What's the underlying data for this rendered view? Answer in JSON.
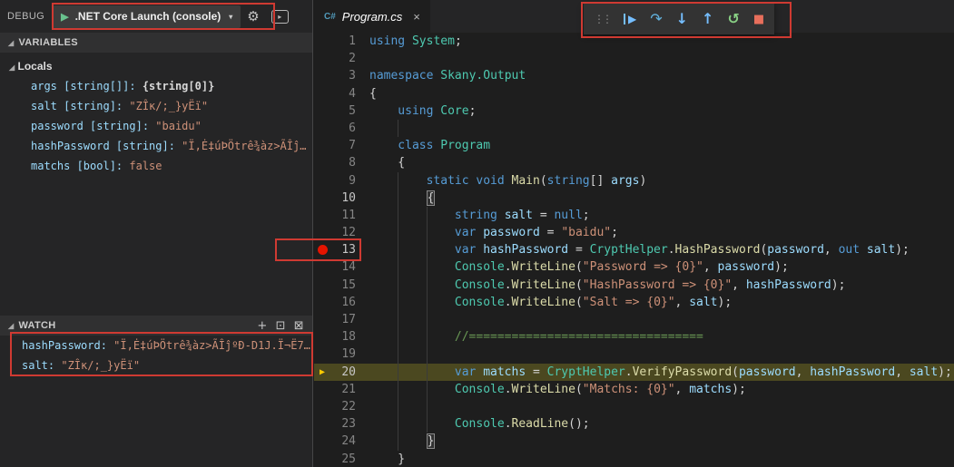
{
  "sidebar": {
    "title": "DEBUG",
    "launch_config": ".NET Core Launch (console)",
    "variables_header": "VARIABLES",
    "locals_label": "Locals",
    "watch_header": "WATCH",
    "variables": [
      {
        "name": "args [string[]]:",
        "value": "{string[0]}",
        "kind": "obj"
      },
      {
        "name": "salt [string]:",
        "value": "\"ZÎĸ/;_}yËï\"",
        "kind": "str"
      },
      {
        "name": "password [string]:",
        "value": "\"baidu\"",
        "kind": "str"
      },
      {
        "name": "hashPassword [string]:",
        "value": "\"Ï,Ė‡úÞÖtrê¾àz>ÃÎĵ…",
        "kind": "str"
      },
      {
        "name": "matchs [bool]:",
        "value": "false",
        "kind": "bool"
      }
    ],
    "watch": [
      {
        "name": "hashPassword:",
        "value": "\"Ï,Ė‡úÞÖtrê¾àz>ÃÎĵºÐ-D1J.Ï¬Ë7…"
      },
      {
        "name": "salt:",
        "value": "\"ZÎĸ/;_}yËï\""
      }
    ],
    "icons": {
      "twisty": "◢",
      "play": "▶",
      "caret": "▾",
      "gear": "⚙",
      "console": "▸",
      "add": "+",
      "collapse": "⊡",
      "close": "⊠"
    }
  },
  "toolbar": {
    "grip": "⋮⋮",
    "continue": "▶",
    "step_over": "↷",
    "step_into": "↓",
    "step_out": "↑",
    "restart": "↺",
    "stop": "■"
  },
  "tab": {
    "icon": "C#",
    "label": "Program.cs",
    "close": "×"
  },
  "editor": {
    "breakpoint_line": 13,
    "current_line": 20,
    "lines": [
      {
        "n": 1,
        "i": 0,
        "t": [
          [
            "kw",
            "using"
          ],
          [
            "pl",
            " "
          ],
          [
            "cls",
            "System"
          ],
          [
            "pl",
            ";"
          ]
        ]
      },
      {
        "n": 2,
        "i": 0,
        "t": []
      },
      {
        "n": 3,
        "i": 0,
        "t": [
          [
            "kw",
            "namespace"
          ],
          [
            "pl",
            " "
          ],
          [
            "cls",
            "Skany.Output"
          ]
        ]
      },
      {
        "n": 4,
        "i": 0,
        "t": [
          [
            "pl",
            "{"
          ]
        ]
      },
      {
        "n": 5,
        "i": 1,
        "t": [
          [
            "kw",
            "using"
          ],
          [
            "pl",
            " "
          ],
          [
            "cls",
            "Core"
          ],
          [
            "pl",
            ";"
          ]
        ]
      },
      {
        "n": 6,
        "i": 2,
        "t": []
      },
      {
        "n": 7,
        "i": 1,
        "t": [
          [
            "kw",
            "class"
          ],
          [
            "pl",
            " "
          ],
          [
            "cls",
            "Program"
          ]
        ]
      },
      {
        "n": 8,
        "i": 1,
        "t": [
          [
            "pl",
            "{"
          ]
        ]
      },
      {
        "n": 9,
        "i": 2,
        "t": [
          [
            "kw",
            "static"
          ],
          [
            "pl",
            " "
          ],
          [
            "kw",
            "void"
          ],
          [
            "pl",
            " "
          ],
          [
            "fn",
            "Main"
          ],
          [
            "pl",
            "("
          ],
          [
            "kw",
            "string"
          ],
          [
            "pl",
            "[] "
          ],
          [
            "vr",
            "args"
          ],
          [
            "pl",
            ")"
          ]
        ]
      },
      {
        "n": 10,
        "i": 2,
        "t": [
          [
            "brace",
            "{"
          ]
        ],
        "bright": true
      },
      {
        "n": 11,
        "i": 3,
        "t": [
          [
            "kw",
            "string"
          ],
          [
            "pl",
            " "
          ],
          [
            "vr",
            "salt"
          ],
          [
            "pl",
            " = "
          ],
          [
            "kw",
            "null"
          ],
          [
            "pl",
            ";"
          ]
        ]
      },
      {
        "n": 12,
        "i": 3,
        "t": [
          [
            "kw",
            "var"
          ],
          [
            "pl",
            " "
          ],
          [
            "vr",
            "password"
          ],
          [
            "pl",
            " = "
          ],
          [
            "str",
            "\"baidu\""
          ],
          [
            "pl",
            ";"
          ]
        ]
      },
      {
        "n": 13,
        "i": 3,
        "t": [
          [
            "kw",
            "var"
          ],
          [
            "pl",
            " "
          ],
          [
            "vr",
            "hashPassword"
          ],
          [
            "pl",
            " = "
          ],
          [
            "cls",
            "CryptHelper"
          ],
          [
            "pl",
            "."
          ],
          [
            "fn",
            "HashPassword"
          ],
          [
            "pl",
            "("
          ],
          [
            "vr",
            "password"
          ],
          [
            "pl",
            ", "
          ],
          [
            "kw",
            "out"
          ],
          [
            "pl",
            " "
          ],
          [
            "vr",
            "salt"
          ],
          [
            "pl",
            ");"
          ]
        ],
        "bright": true
      },
      {
        "n": 14,
        "i": 3,
        "t": [
          [
            "cls",
            "Console"
          ],
          [
            "pl",
            "."
          ],
          [
            "fn",
            "WriteLine"
          ],
          [
            "pl",
            "("
          ],
          [
            "str",
            "\"Password => {0}\""
          ],
          [
            "pl",
            ", "
          ],
          [
            "vr",
            "password"
          ],
          [
            "pl",
            ");"
          ]
        ]
      },
      {
        "n": 15,
        "i": 3,
        "t": [
          [
            "cls",
            "Console"
          ],
          [
            "pl",
            "."
          ],
          [
            "fn",
            "WriteLine"
          ],
          [
            "pl",
            "("
          ],
          [
            "str",
            "\"HashPassword => {0}\""
          ],
          [
            "pl",
            ", "
          ],
          [
            "vr",
            "hashPassword"
          ],
          [
            "pl",
            ");"
          ]
        ]
      },
      {
        "n": 16,
        "i": 3,
        "t": [
          [
            "cls",
            "Console"
          ],
          [
            "pl",
            "."
          ],
          [
            "fn",
            "WriteLine"
          ],
          [
            "pl",
            "("
          ],
          [
            "str",
            "\"Salt => {0}\""
          ],
          [
            "pl",
            ", "
          ],
          [
            "vr",
            "salt"
          ],
          [
            "pl",
            ");"
          ]
        ]
      },
      {
        "n": 17,
        "i": 3,
        "t": []
      },
      {
        "n": 18,
        "i": 3,
        "t": [
          [
            "cmt",
            "//================================="
          ]
        ]
      },
      {
        "n": 19,
        "i": 3,
        "t": []
      },
      {
        "n": 20,
        "i": 3,
        "t": [
          [
            "kw",
            "var"
          ],
          [
            "pl",
            " "
          ],
          [
            "vr",
            "matchs"
          ],
          [
            "pl",
            " = "
          ],
          [
            "cls",
            "CryptHelper"
          ],
          [
            "pl",
            "."
          ],
          [
            "fn",
            "VerifyPassword"
          ],
          [
            "pl",
            "("
          ],
          [
            "vr",
            "password"
          ],
          [
            "pl",
            ", "
          ],
          [
            "vr",
            "hashPassword"
          ],
          [
            "pl",
            ", "
          ],
          [
            "vr",
            "salt"
          ],
          [
            "pl",
            ");"
          ]
        ],
        "bright": true,
        "current": true
      },
      {
        "n": 21,
        "i": 3,
        "t": [
          [
            "cls",
            "Console"
          ],
          [
            "pl",
            "."
          ],
          [
            "fn",
            "WriteLine"
          ],
          [
            "pl",
            "("
          ],
          [
            "str",
            "\"Matchs: {0}\""
          ],
          [
            "pl",
            ", "
          ],
          [
            "vr",
            "matchs"
          ],
          [
            "pl",
            ");"
          ]
        ]
      },
      {
        "n": 22,
        "i": 3,
        "t": []
      },
      {
        "n": 23,
        "i": 3,
        "t": [
          [
            "cls",
            "Console"
          ],
          [
            "pl",
            "."
          ],
          [
            "fn",
            "ReadLine"
          ],
          [
            "pl",
            "();"
          ]
        ]
      },
      {
        "n": 24,
        "i": 2,
        "t": [
          [
            "brace",
            "}"
          ]
        ]
      },
      {
        "n": 25,
        "i": 1,
        "t": [
          [
            "pl",
            "}"
          ]
        ]
      }
    ]
  },
  "colors": {
    "accent_annotation": "#cf3a32",
    "breakpoint": "#e51400",
    "current_line_bg": "#4b4820",
    "keyword": "#569cd6",
    "type": "#4ec9b0",
    "method": "#dcdcaa",
    "string": "#ce9178",
    "comment": "#6a9955"
  }
}
